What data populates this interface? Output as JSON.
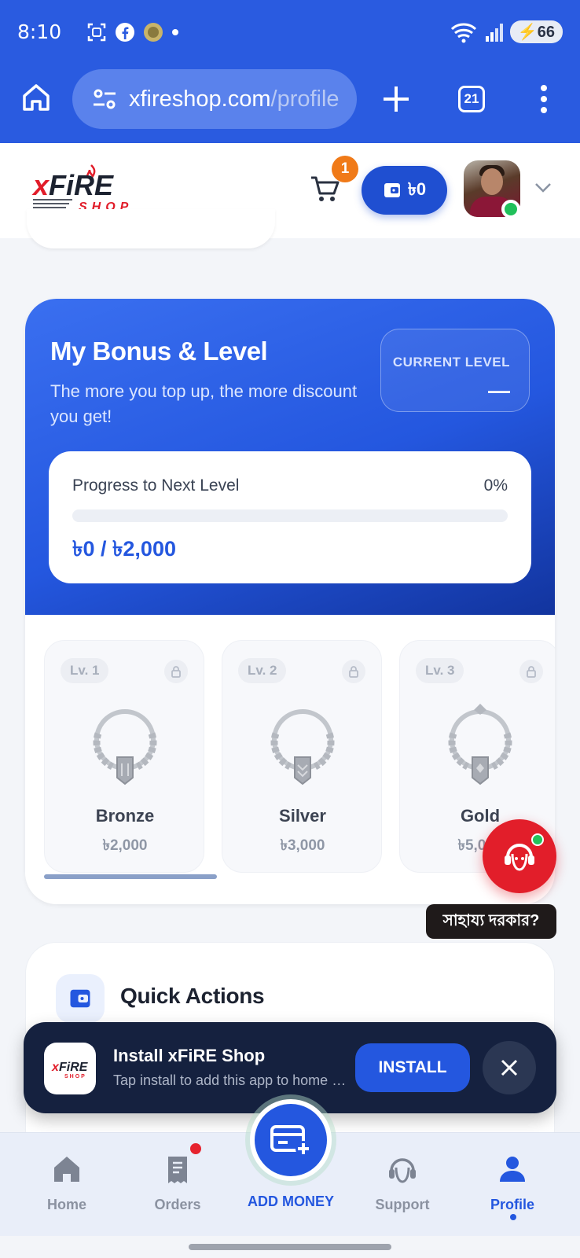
{
  "status_bar": {
    "time": "8:10",
    "battery": "66",
    "wifi_label": "5"
  },
  "browser": {
    "url_main": "xfireshop.com",
    "url_path": "/profile",
    "tab_count": "21"
  },
  "header": {
    "cart_count": "1",
    "wallet_balance": "৳0"
  },
  "bonus": {
    "title": "My Bonus & Level",
    "subtitle": "The more you top up, the more discount you get!",
    "current_level_label": "CURRENT LEVEL",
    "current_level_value": "—",
    "progress_label": "Progress to Next Level",
    "progress_percent": "0%",
    "progress_fraction": 0,
    "progress_amount": "৳0 / ৳2,000"
  },
  "levels": [
    {
      "tag": "Lv. 1",
      "name": "Bronze",
      "amount": "৳2,000"
    },
    {
      "tag": "Lv. 2",
      "name": "Silver",
      "amount": "৳3,000"
    },
    {
      "tag": "Lv. 3",
      "name": "Gold",
      "amount": "৳5,000"
    }
  ],
  "help_bubble": "সাহায্য দরকার?",
  "quick_actions": {
    "title": "Quick Actions"
  },
  "install_banner": {
    "title": "Install xFiRE Shop",
    "subtitle": "Tap install to add this app to home screen",
    "button": "INSTALL"
  },
  "bottom_nav": {
    "home": "Home",
    "orders": "Orders",
    "add_money": "ADD MONEY",
    "support": "Support",
    "profile": "Profile"
  },
  "colors": {
    "brand_blue": "#2457df",
    "browser_blue": "#2a5be0",
    "accent_orange": "#f07a18",
    "support_red": "#e21e2a",
    "online_green": "#20c05a"
  }
}
